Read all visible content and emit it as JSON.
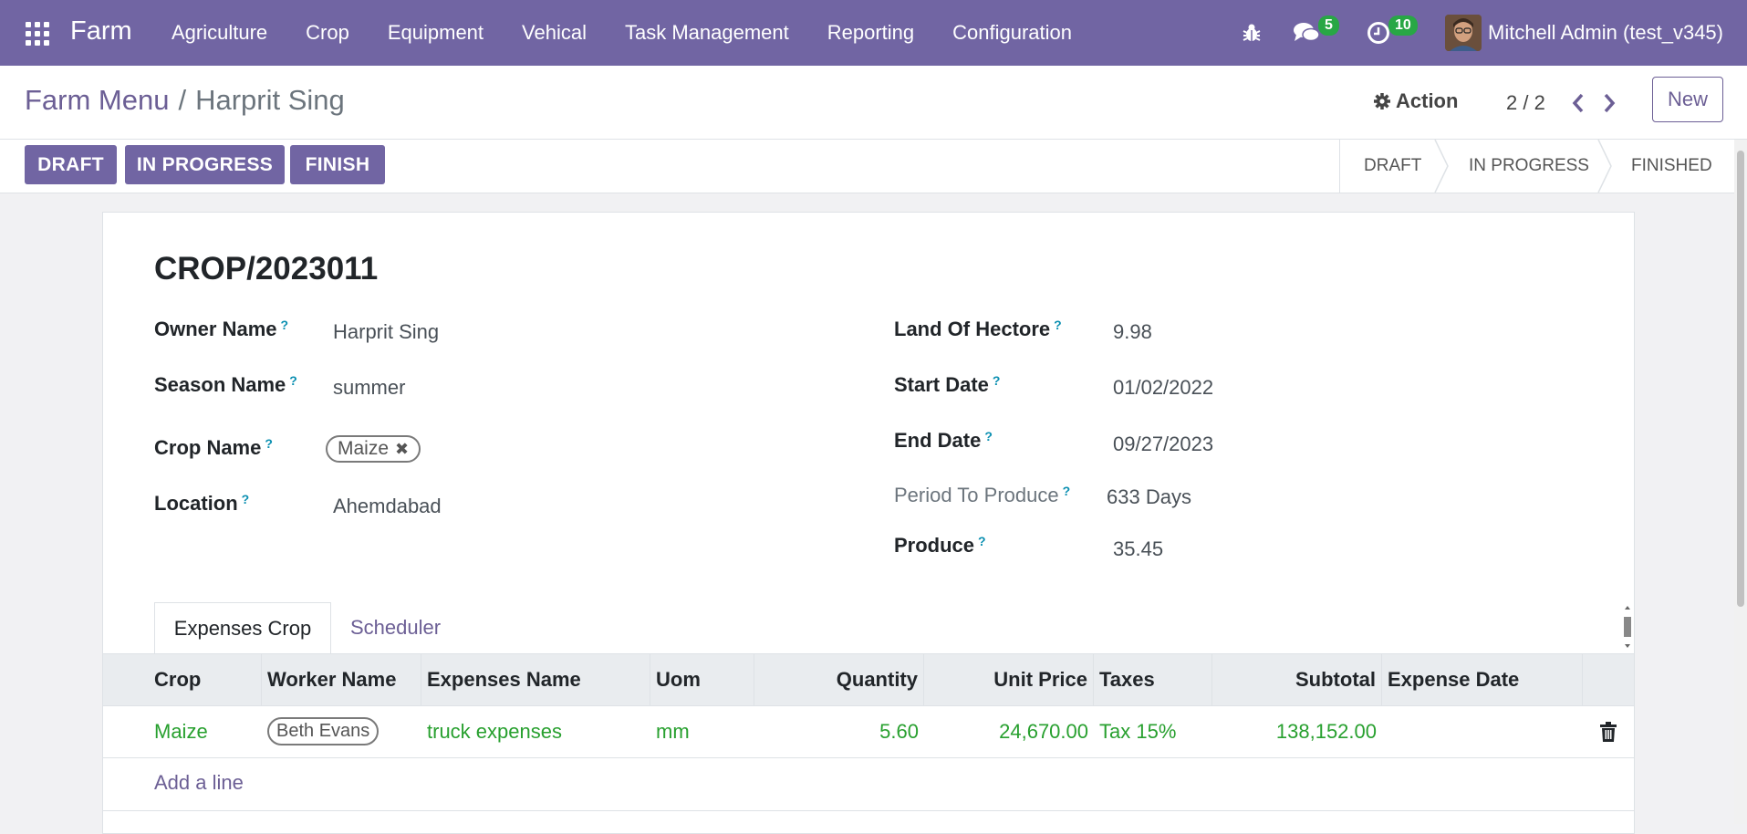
{
  "navbar": {
    "brand": "Farm",
    "menu": [
      "Agriculture",
      "Crop",
      "Equipment",
      "Vehical",
      "Task Management",
      "Reporting",
      "Configuration"
    ],
    "messages_count": "5",
    "activities_count": "10",
    "user_name": "Mitchell Admin (test_v345)",
    "icons": [
      "apps-grid-icon",
      "bug-icon",
      "chat-icon",
      "clock-icon"
    ]
  },
  "control": {
    "breadcrumb_parent": "Farm Menu",
    "breadcrumb_sep": "/",
    "breadcrumb_current": "Harprit Sing",
    "action_label": "Action",
    "pager": "2 / 2",
    "new_label": "New"
  },
  "statusbar": {
    "buttons": [
      "DRAFT",
      "IN PROGRESS",
      "FINISH"
    ],
    "stages": [
      "DRAFT",
      "IN PROGRESS",
      "FINISHED"
    ]
  },
  "form": {
    "title": "CROP/2023011",
    "owner_name_label": "Owner Name",
    "owner_name": "Harprit Sing",
    "season_name_label": "Season Name",
    "season_name": "summer",
    "crop_name_label": "Crop Name",
    "crop_name_tag": "Maize",
    "location_label": "Location",
    "location": "Ahemdabad",
    "land_label": "Land Of Hectore",
    "land": "9.98",
    "start_date_label": "Start Date",
    "start_date": "01/02/2022",
    "end_date_label": "End Date",
    "end_date": "09/27/2023",
    "period_label": "Period To Produce",
    "period": "633 Days",
    "produce_label": "Produce",
    "produce": "35.45",
    "help_mark": "?"
  },
  "tabs": [
    "Expenses Crop",
    "Scheduler"
  ],
  "table": {
    "columns": [
      "Crop",
      "Worker Name",
      "Expenses Name",
      "Uom",
      "Quantity",
      "Unit Price",
      "Taxes",
      "Subtotal",
      "Expense Date"
    ],
    "rows": [
      {
        "crop": "Maize",
        "worker": "Beth Evans",
        "expense": "truck expenses",
        "uom": "mm",
        "quantity": "5.60",
        "unit_price": "24,670.00",
        "taxes": "Tax 15%",
        "subtotal": "138,152.00",
        "expense_date": ""
      }
    ],
    "add_line": "Add a line"
  },
  "colors": {
    "brand": "#7165a3",
    "link": "#6c5f95",
    "row_text": "#28a02f",
    "badge": "#28a745"
  }
}
